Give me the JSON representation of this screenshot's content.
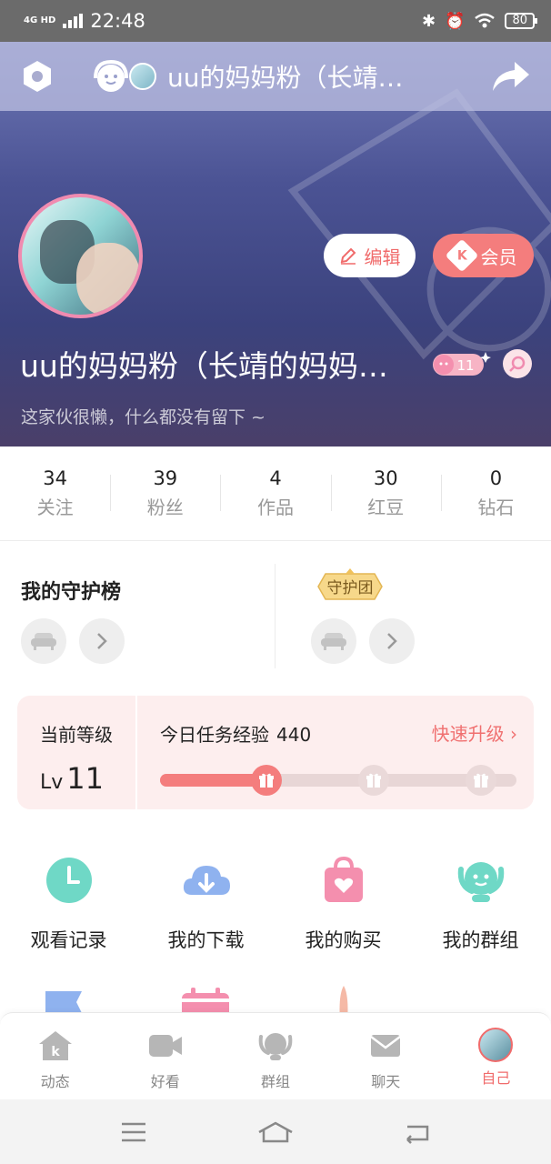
{
  "status_bar": {
    "network": "4G HD",
    "time": "22:48",
    "battery": "80"
  },
  "header": {
    "title": "uu的妈妈粉（长靖…"
  },
  "profile": {
    "name": "uu的妈妈粉（长靖的妈妈…",
    "bio": "这家伙很懒，什么都没有留下 ~",
    "edit_label": "编辑",
    "vip_label": "会员",
    "vip_icon_letter": "K",
    "level_badge": "11"
  },
  "stats": [
    {
      "value": "34",
      "label": "关注"
    },
    {
      "value": "39",
      "label": "粉丝"
    },
    {
      "value": "4",
      "label": "作品"
    },
    {
      "value": "30",
      "label": "红豆"
    },
    {
      "value": "0",
      "label": "钻石"
    }
  ],
  "guard": {
    "title": "我的守护榜",
    "team_badge": "守护团"
  },
  "level": {
    "current_label": "当前等级",
    "lv_prefix": "Lv",
    "lv_value": "11",
    "task_label": "今日任务经验",
    "task_value": "440",
    "quick_upgrade": "快速升级",
    "progress_fraction": 0.3
  },
  "menu": [
    {
      "label": "观看记录",
      "icon": "clock-icon"
    },
    {
      "label": "我的下载",
      "icon": "cloud-download-icon"
    },
    {
      "label": "我的购买",
      "icon": "shopping-bag-icon"
    },
    {
      "label": "我的群组",
      "icon": "group-icon"
    }
  ],
  "bottom_nav": [
    {
      "label": "动态",
      "icon": "home-k-icon"
    },
    {
      "label": "好看",
      "icon": "video-camera-icon"
    },
    {
      "label": "群组",
      "icon": "group-icon"
    },
    {
      "label": "聊天",
      "icon": "mail-icon"
    },
    {
      "label": "自己",
      "icon": "avatar"
    }
  ],
  "colors": {
    "accent": "#f47d7d",
    "hero": "#4b5394",
    "level_card": "#fdeeee"
  }
}
